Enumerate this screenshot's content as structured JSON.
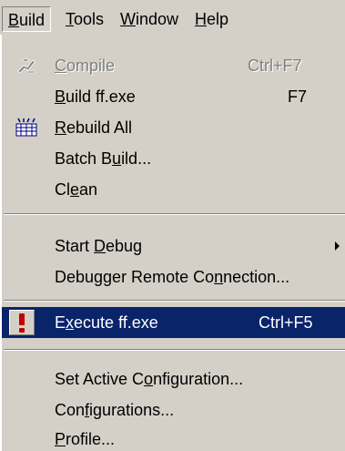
{
  "menubar": {
    "items": [
      {
        "pre": "",
        "key": "B",
        "post": "uild"
      },
      {
        "pre": "",
        "key": "T",
        "post": "ools"
      },
      {
        "pre": "",
        "key": "W",
        "post": "indow"
      },
      {
        "pre": "",
        "key": "H",
        "post": "elp"
      }
    ]
  },
  "menu": {
    "items": [
      {
        "pre": "",
        "key": "C",
        "post": "ompile",
        "accel": "Ctrl+F7",
        "disabled": true,
        "icon": "compile-icon"
      },
      {
        "pre": "",
        "key": "B",
        "post": "uild ff.exe",
        "accel": "F7"
      },
      {
        "pre": "",
        "key": "R",
        "post": "ebuild All",
        "accel": "",
        "icon": "rebuild-all-icon"
      },
      {
        "pre": "Batch B",
        "key": "u",
        "post": "ild...",
        "accel": ""
      },
      {
        "pre": "Cl",
        "key": "e",
        "post": "an",
        "accel": ""
      },
      {
        "pre": "Start ",
        "key": "D",
        "post": "ebug",
        "accel": "",
        "submenu": true
      },
      {
        "pre": "Debugger Remote Co",
        "key": "n",
        "post": "nection...",
        "accel": ""
      },
      {
        "pre": "E",
        "key": "x",
        "post": "ecute ff.exe",
        "accel": "Ctrl+F5",
        "highlighted": true,
        "icon": "exclamation-icon"
      },
      {
        "pre": "Set Active C",
        "key": "o",
        "post": "nfiguration...",
        "accel": ""
      },
      {
        "pre": "Con",
        "key": "f",
        "post": "igurations...",
        "accel": ""
      },
      {
        "pre": "",
        "key": "P",
        "post": "rofile...",
        "accel": ""
      }
    ]
  },
  "colors": {
    "face": "#d4d0c8",
    "highlight": "#0a246a",
    "highlight_text": "#ffffff",
    "disabled_text": "#808080",
    "exclamation": "#c00000"
  }
}
